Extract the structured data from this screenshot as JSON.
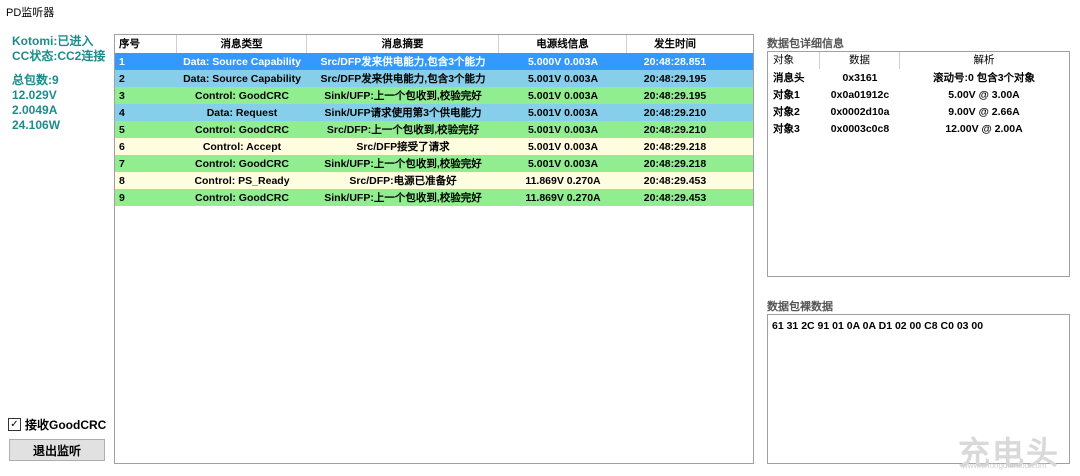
{
  "window": {
    "title": "PD监听器"
  },
  "status": {
    "device": "Kotomi:已进入",
    "cc_state": "CC状态:CC2连接",
    "packet_count": "总包数:9",
    "voltage": "12.029V",
    "current": "2.0049A",
    "power": "24.106W"
  },
  "colors": {
    "status_text": "#1e8c8c",
    "selected_row": "#3399ff",
    "source_capability": "#87ceeb",
    "request": "#87ceeb",
    "goodcrc": "#90ee90",
    "accept": "#fffde0",
    "ps_ready": "#fffde0"
  },
  "controls": {
    "goodcrc_label": "接收GoodCRC",
    "goodcrc_checked": true,
    "exit_button": "退出监听"
  },
  "table": {
    "columns": [
      "序号",
      "消息类型",
      "消息摘要",
      "电源线信息",
      "发生时间"
    ],
    "rows": [
      {
        "cells": [
          "1",
          "Data: Source Capability",
          "Src/DFP发来供电能力,包含3个能力",
          "5.000V 0.003A",
          "20:48:28.851"
        ],
        "color": "#3399ff",
        "text_color": "#ffffff",
        "selected": true
      },
      {
        "cells": [
          "2",
          "Data: Source Capability",
          "Src/DFP发来供电能力,包含3个能力",
          "5.001V 0.003A",
          "20:48:29.195"
        ],
        "color": "#87ceeb",
        "text_color": "#000000",
        "selected": false
      },
      {
        "cells": [
          "3",
          "Control: GoodCRC",
          "Sink/UFP:上一个包收到,校验完好",
          "5.001V 0.003A",
          "20:48:29.195"
        ],
        "color": "#90ee90",
        "text_color": "#000000",
        "selected": false
      },
      {
        "cells": [
          "4",
          "Data: Request",
          "Sink/UFP请求使用第3个供电能力",
          "5.001V 0.003A",
          "20:48:29.210"
        ],
        "color": "#87ceeb",
        "text_color": "#000000",
        "selected": false
      },
      {
        "cells": [
          "5",
          "Control: GoodCRC",
          "Src/DFP:上一个包收到,校验完好",
          "5.001V 0.003A",
          "20:48:29.210"
        ],
        "color": "#90ee90",
        "text_color": "#000000",
        "selected": false
      },
      {
        "cells": [
          "6",
          "Control: Accept",
          "Src/DFP接受了请求",
          "5.001V 0.003A",
          "20:48:29.218"
        ],
        "color": "#fffde0",
        "text_color": "#000000",
        "selected": false
      },
      {
        "cells": [
          "7",
          "Control: GoodCRC",
          "Sink/UFP:上一个包收到,校验完好",
          "5.001V 0.003A",
          "20:48:29.218"
        ],
        "color": "#90ee90",
        "text_color": "#000000",
        "selected": false
      },
      {
        "cells": [
          "8",
          "Control: PS_Ready",
          "Src/DFP:电源已准备好",
          "11.869V 0.270A",
          "20:48:29.453"
        ],
        "color": "#fffde0",
        "text_color": "#000000",
        "selected": false
      },
      {
        "cells": [
          "9",
          "Control: GoodCRC",
          "Sink/UFP:上一个包收到,校验完好",
          "11.869V 0.270A",
          "20:48:29.453"
        ],
        "color": "#90ee90",
        "text_color": "#000000",
        "selected": false
      }
    ]
  },
  "detail": {
    "label": "数据包详细信息",
    "columns": [
      "对象",
      "数据",
      "解析"
    ],
    "rows": [
      [
        "消息头",
        "0x3161",
        "滚动号:0 包含3个对象"
      ],
      [
        "对象1",
        "0x0a01912c",
        "5.00V @ 3.00A"
      ],
      [
        "对象2",
        "0x0002d10a",
        "9.00V @ 2.66A"
      ],
      [
        "对象3",
        "0x0003c0c8",
        "12.00V @ 2.00A"
      ]
    ]
  },
  "raw": {
    "label": "数据包裸数据",
    "bytes": "61 31 2C 91 01 0A 0A D1 02 00 C8 C0 03 00"
  },
  "watermark": {
    "logo": "充电头",
    "url": "www.chongdiantou.com"
  }
}
